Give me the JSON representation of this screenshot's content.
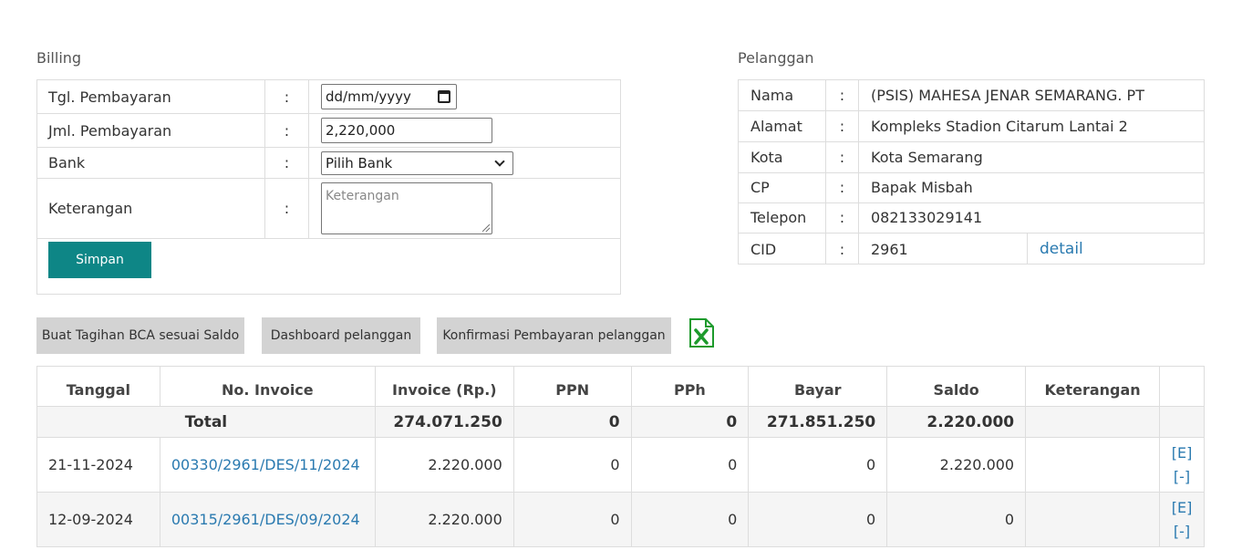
{
  "billing": {
    "title": "Billing",
    "rows": [
      {
        "label": "Tgl. Pembayaran",
        "colon": ":",
        "value": "dd/mm/yyyy"
      },
      {
        "label": "Jml. Pembayaran",
        "colon": ":",
        "value": "2,220,000"
      },
      {
        "label": "Bank",
        "colon": ":",
        "value": "Pilih Bank"
      },
      {
        "label": "Keterangan",
        "colon": ":",
        "placeholder": "Keterangan"
      }
    ],
    "save_label": "Simpan"
  },
  "pelanggan": {
    "title": "Pelanggan",
    "rows": [
      {
        "label": "Nama",
        "colon": ":",
        "value": "(PSIS) MAHESA JENAR SEMARANG. PT"
      },
      {
        "label": "Alamat",
        "colon": ":",
        "value": "Kompleks Stadion Citarum Lantai 2"
      },
      {
        "label": "Kota",
        "colon": ":",
        "value": "Kota Semarang"
      },
      {
        "label": "CP",
        "colon": ":",
        "value": "Bapak Misbah"
      },
      {
        "label": "Telepon",
        "colon": ":",
        "value": "082133029141"
      },
      {
        "label": "CID",
        "colon": ":",
        "value": "2961",
        "link": "detail"
      }
    ]
  },
  "actions": {
    "buat_tagihan": "Buat Tagihan BCA sesuai Saldo",
    "dashboard": "Dashboard pelanggan",
    "konfirmasi": "Konfirmasi Pembayaran pelanggan",
    "excel_icon": "excel-icon"
  },
  "invoices": {
    "headers": [
      "Tanggal",
      "No. Invoice",
      "Invoice (Rp.)",
      "PPN",
      "PPh",
      "Bayar",
      "Saldo",
      "Keterangan",
      ""
    ],
    "total": {
      "label": "Total",
      "invoice": "274.071.250",
      "ppn": "0",
      "pph": "0",
      "bayar": "271.851.250",
      "saldo": "2.220.000"
    },
    "rows": [
      {
        "tanggal": "21-11-2024",
        "no": "00330/2961/DES/11/2024",
        "invoice": "2.220.000",
        "ppn": "0",
        "pph": "0",
        "bayar": "0",
        "saldo": "2.220.000",
        "keterangan": "",
        "edit": "[E]",
        "delete": "[-]"
      },
      {
        "tanggal": "12-09-2024",
        "no": "00315/2961/DES/09/2024",
        "invoice": "2.220.000",
        "ppn": "0",
        "pph": "0",
        "bayar": "0",
        "saldo": "0",
        "keterangan": "",
        "edit": "[E]",
        "delete": "[-]"
      }
    ]
  },
  "colors": {
    "accent": "#0e8686",
    "link": "#2a7ab0",
    "button_gray": "#d3d3d3",
    "excel_green": "#1d9a2c"
  }
}
